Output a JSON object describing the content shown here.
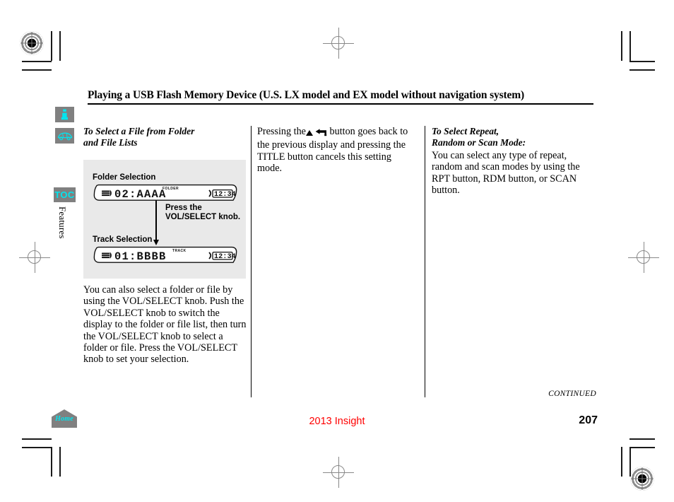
{
  "document": {
    "chapter_title": "Playing a USB Flash Memory Device (U.S. LX model and EX model without navigation system)",
    "model_year": "2013 Insight",
    "page_number": "207",
    "continued_label": "CONTINUED"
  },
  "sidebar": {
    "toc_label": "TOC",
    "section_label": "Features",
    "icons": [
      {
        "name": "info-icon",
        "glyph": "i"
      },
      {
        "name": "vehicle-icon",
        "glyph": "car"
      }
    ]
  },
  "columns": {
    "left": {
      "subhead_line1": "To Select a File from Folder",
      "subhead_line2": "and File Lists",
      "body": "You can also select a folder or file by using the VOL/SELECT knob. Push the VOL/SELECT knob to switch the display to the folder or file list, then turn the VOL/SELECT knob to select a folder or file. Press the VOL/SELECT knob to set your selection."
    },
    "middle": {
      "body_before_icons": "Pressing the",
      "body_after_icons": "button goes back to the previous display and pressing the TITLE button cancels this setting mode.",
      "icons": [
        "triangle-up-icon",
        "back-arrow-icon"
      ]
    },
    "right": {
      "subhead_line1": "To Select Repeat,",
      "subhead_line2": "Random or Scan Mode:",
      "body": "You can select any type of repeat, random and scan modes by using the RPT button, RDM button, or SCAN button."
    }
  },
  "figure": {
    "folder_label": "Folder Selection",
    "track_label": "Track Selection",
    "callout_line1": "Press the",
    "callout_line2": "VOL/SELECT knob.",
    "displays": [
      {
        "name": "folder-selection-display",
        "mode_label": "FOLDER",
        "text": "02:AAAA",
        "clock": "12:34"
      },
      {
        "name": "track-selection-display",
        "mode_label": "TRACK",
        "text": "01:BBBB",
        "clock": "12:34"
      }
    ]
  },
  "home_button": {
    "label": "Home"
  },
  "colors": {
    "accent_cyan": "#00e5ee",
    "sidebar_gray": "#808080",
    "figure_bg": "#e9e9e9",
    "model_red": "#ff0000"
  }
}
